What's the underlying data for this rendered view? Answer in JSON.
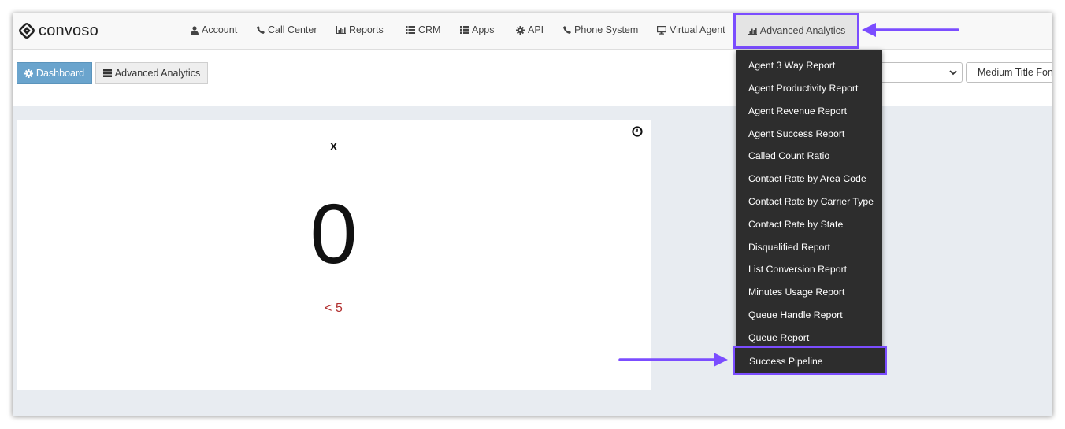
{
  "brand": {
    "name": "convoso"
  },
  "nav": {
    "items": [
      {
        "label": "Account",
        "icon": "user-icon"
      },
      {
        "label": "Call Center",
        "icon": "phone-icon"
      },
      {
        "label": "Reports",
        "icon": "bar-chart-icon"
      },
      {
        "label": "CRM",
        "icon": "list-icon"
      },
      {
        "label": "Apps",
        "icon": "grid-icon"
      },
      {
        "label": "API",
        "icon": "gear-icon"
      },
      {
        "label": "Phone System",
        "icon": "phone-icon"
      },
      {
        "label": "Virtual Agent",
        "icon": "monitor-icon"
      }
    ],
    "active": {
      "label": "Advanced Analytics",
      "icon": "bar-chart-icon"
    }
  },
  "toolbar": {
    "dashboard_label": "Dashboard",
    "analytics_label": "Advanced Analytics",
    "font_select_value": "Medium Title Fon"
  },
  "widget": {
    "title": "x",
    "value": "0",
    "threshold": "< 5"
  },
  "dropdown": {
    "items": [
      "Agent 3 Way Report",
      "Agent Productivity Report",
      "Agent Revenue Report",
      "Agent Success Report",
      "Called Count Ratio",
      "Contact Rate by Area Code",
      "Contact Rate by Carrier Type",
      "Contact Rate by State",
      "Disqualified Report",
      "List Conversion Report",
      "Minutes Usage Report",
      "Queue Handle Report",
      "Queue Report"
    ],
    "highlighted": "Success Pipeline"
  },
  "colors": {
    "highlight": "#7b4dff",
    "dashboard_button": "#6aa4cd",
    "dropdown_bg": "#2d2d2d",
    "threshold_text": "#b23030"
  }
}
